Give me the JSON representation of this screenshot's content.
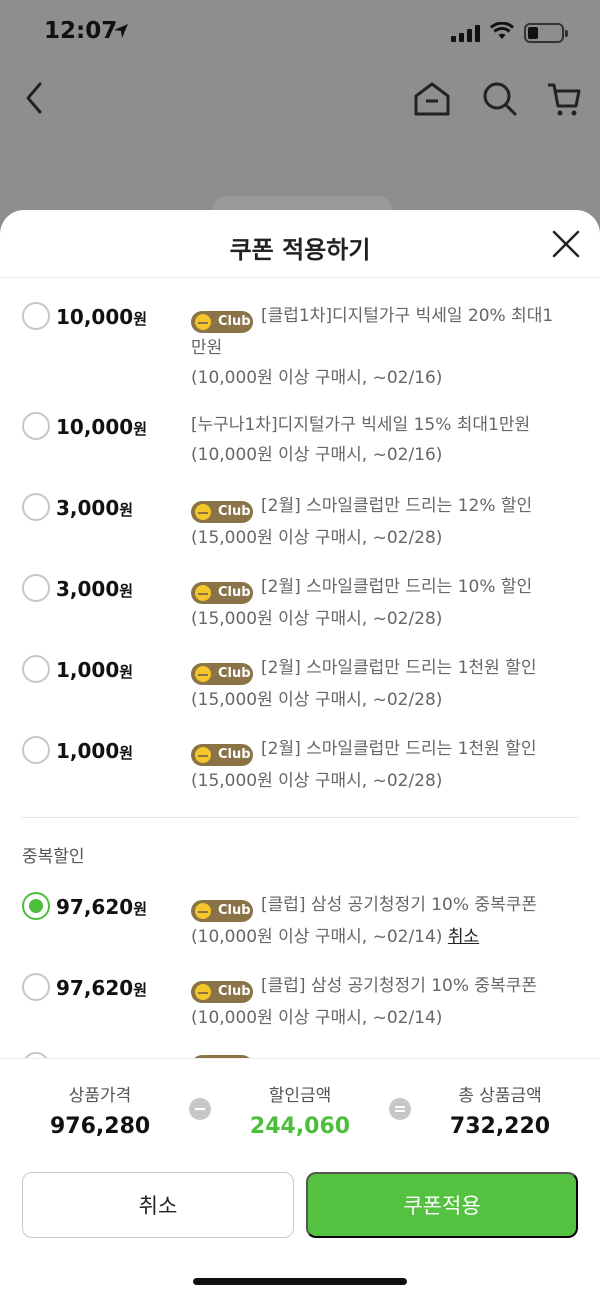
{
  "status_bar": {
    "time": "12:07"
  },
  "sheet": {
    "title": "쿠폰 적용하기"
  },
  "coupons": [
    {
      "amount": "10,000",
      "won": "원",
      "club": true,
      "club_label": "Club",
      "line1": "[클럽1차]디지털가구 빅세일 20% 최대1",
      "line2": "만원",
      "line3": "(10,000원 이상 구매시, ~02/16)",
      "checked": false
    },
    {
      "amount": "10,000",
      "won": "원",
      "club": false,
      "line1": "[누구나1차]디지털가구 빅세일 15% 최대1만원",
      "line2": "(10,000원 이상 구매시, ~02/16)",
      "checked": false
    },
    {
      "amount": "3,000",
      "won": "원",
      "club": true,
      "club_label": "Club",
      "line1": "[2월] 스마일클럽만 드리는 12% 할인",
      "line2": "(15,000원 이상 구매시, ~02/28)",
      "checked": false
    },
    {
      "amount": "3,000",
      "won": "원",
      "club": true,
      "club_label": "Club",
      "line1": "[2월] 스마일클럽만 드리는 10% 할인",
      "line2": "(15,000원 이상 구매시, ~02/28)",
      "checked": false
    },
    {
      "amount": "1,000",
      "won": "원",
      "club": true,
      "club_label": "Club",
      "line1": "[2월] 스마일클럽만 드리는 1천원 할인",
      "line2": "(15,000원 이상 구매시, ~02/28)",
      "checked": false
    },
    {
      "amount": "1,000",
      "won": "원",
      "club": true,
      "club_label": "Club",
      "line1": "[2월] 스마일클럽만 드리는 1천원 할인",
      "line2": "(15,000원 이상 구매시, ~02/28)",
      "checked": false
    }
  ],
  "duplicate_section": {
    "label": "중복할인",
    "coupons": [
      {
        "amount": "97,620",
        "won": "원",
        "club_label": "Club",
        "line1": "[클럽] 삼성 공기청정기 10% 중복쿠폰",
        "line2": "(10,000원 이상 구매시, ~02/14)",
        "cancel": "취소",
        "checked": true
      },
      {
        "amount": "97,620",
        "won": "원",
        "club_label": "Club",
        "line1": "[클럽] 삼성 공기청정기 10% 중복쿠폰",
        "line2": "(10,000원 이상 구매시, ~02/14)",
        "checked": false
      }
    ]
  },
  "summary": {
    "product_price_label": "상품가격",
    "product_price": "976,280",
    "discount_label": "할인금액",
    "discount": "244,060",
    "total_label": "총 상품금액",
    "total": "732,220"
  },
  "buttons": {
    "cancel": "취소",
    "apply": "쿠폰적용"
  },
  "colors": {
    "accent_green": "#55c140",
    "club_brown": "#8a7447",
    "club_yellow": "#f6c52a"
  }
}
